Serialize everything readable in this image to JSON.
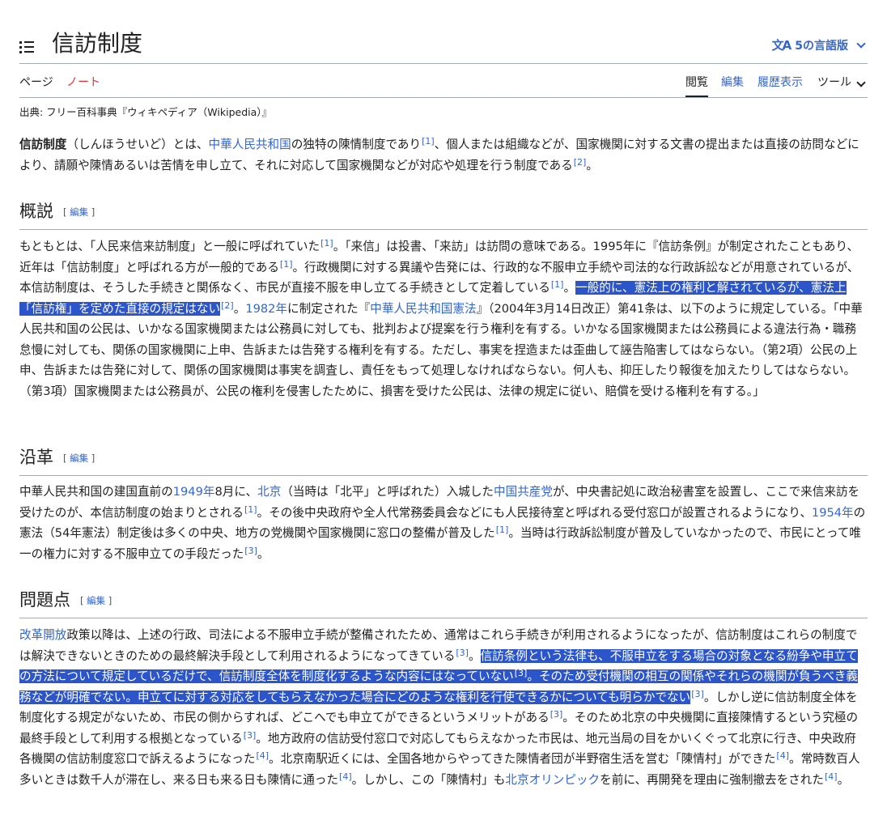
{
  "header": {
    "title": "信訪制度",
    "languages_label": "5の言語版",
    "languages_icon": "translate-icon"
  },
  "tabs": {
    "page": "ページ",
    "talk": "ノート",
    "view": "閲覧",
    "edit": "編集",
    "history": "履歴表示",
    "tools": "ツール"
  },
  "tagline": "出典: フリー百科事典『ウィキペディア（Wikipedia）』",
  "edit_label": "編集",
  "intro": {
    "t1": "信訪制度",
    "t2": "（しんほうせいど）とは、",
    "l1": "中華人民共和国",
    "t3": "の独特の陳情制度であり",
    "r1": "[1]",
    "t4": "、個人または組織などが、国家機関に対する文書の提出または直接の訪問などにより、請願や陳情あるいは苦情を申し立て、それに対応して国家機関などが対応や処理を行う制度である",
    "r2": "[2]",
    "t5": "。"
  },
  "sections": {
    "overview": {
      "heading": "概説",
      "t1": "もともとは、「人民来信来訪制度」と一般に呼ばれていた",
      "r1": "[1]",
      "t2": "。「来信」は投書、「来訪」は訪問の意味である。1995年に『信訪条例』が制定されたこともあり、近年は「信訪制度」と呼ばれる方が一般的である",
      "r2": "[1]",
      "t3": "。行政機関に対する異議や告発には、行政的な不服申立手続や司法的な行政訴訟などが用意されているが、本信訪制度は、そうした手続きと関係なく、市民が直接不服を申し立てる手続きとして定着している",
      "r3": "[1]",
      "t4": "。",
      "h1": "一般的に、憲法上の権利と解されているが、憲法上「信訪権」を定めた直接の規定はない",
      "r4": "[2]",
      "t5": "。",
      "l1": "1982年",
      "t6": "に制定された『",
      "l2": "中華人民共和国憲法",
      "t7": "』（2004年3月14日改正）第41条は、以下のように規定している。「中華人民共和国の公民は、いかなる国家機関または公務員に対しても、批判および提案を行う権利を有する。いかなる国家機関または公務員による違法行為・職務怠慢に対しても、関係の国家機関に上申、告訴または告発する権利を有する。ただし、事実を捏造または歪曲して誣告陥害してはならない。（第2項）公民の上申、告訴または告発に対して、関係の国家機関は事実を調査し、責任をもって処理しなければならない。何人も、抑圧したり報復を加えたりしてはならない。（第3項）国家機関または公務員が、公民の権利を侵害したために、損害を受けた公民は、法律の規定に従い、賠償を受ける権利を有する。」"
    },
    "history": {
      "heading": "沿革",
      "t1": "中華人民共和国の建国直前の",
      "l1": "1949年",
      "t2": "8月に、",
      "l2": "北京",
      "t3": "（当時は「北平」と呼ばれた）入城した",
      "l3": "中国共産党",
      "t4": "が、中央書記処に政治秘書室を設置し、ここで来信来訪を受けたのが、本信訪制度の始まりとされる",
      "r1": "[1]",
      "t5": "。その後中央政府や全人代常務委員会などにも人民接待室と呼ばれる受付窓口が設置されるようになり、",
      "l4": "1954年",
      "t6": "の憲法（54年憲法）制定後は多くの中央、地方の党機関や国家機関に窓口の整備が普及した",
      "r2": "[1]",
      "t7": "。当時は行政訴訟制度が普及していなかったので、市民にとって唯一の権力に対する不服申立ての手段だった",
      "r3": "[3]",
      "t8": "。"
    },
    "problems": {
      "heading": "問題点",
      "l1": "改革開放",
      "t1": "政策以降は、上述の行政、司法による不服申立手続が整備されたため、通常はこれら手続きが利用されるようになったが、信訪制度はこれらの制度では解決できないときのための最終解決手段として利用されるようになってきている",
      "r1": "[3]",
      "t2": "。",
      "h1": "信訪条例という法律も、不服申立をする場合の対象となる紛争や申立ての方法について規定しているだけで、信訪制度全体を制度化するような内容にはなっていない",
      "r2": "[3]",
      "h2": "。そのため受付機関の相互の関係やそれらの機関が負うべき義務などが明確でない。申立てに対する対応をしてもらえなかった場合にどのような権利を行使できるかについても明らかでない",
      "r3": "[3]",
      "t3": "。しかし逆に信訪制度全体を制度化する規定がないため、市民の側からすれば、どこへでも申立てができるというメリットがある",
      "r4": "[3]",
      "t4": "。そのため北京の中央機関に直接陳情するという究極の最終手段として利用する根拠となっている",
      "r5": "[3]",
      "t5": "。地方政府の信訪受付窓口で対応してもらえなかった市民は、地元当局の目をかいくぐって北京に行き、中央政府各機関の信訪制度窓口で訴えるようになった",
      "r6": "[4]",
      "t6": "。北京南駅近くには、全国各地からやってきた陳情者団が半野宿生活を営む「陳情村」ができた",
      "r7": "[4]",
      "t7": "。常時数百人多いときは数千人が滞在し、来る日も来る日も陳情に通った",
      "r8": "[4]",
      "t8": "。しかし、この「陳情村」も",
      "l2": "北京オリンピック",
      "t9": "を前に、再開発を理由に強制撤去をされた",
      "r9": "[4]",
      "t10": "。"
    }
  }
}
